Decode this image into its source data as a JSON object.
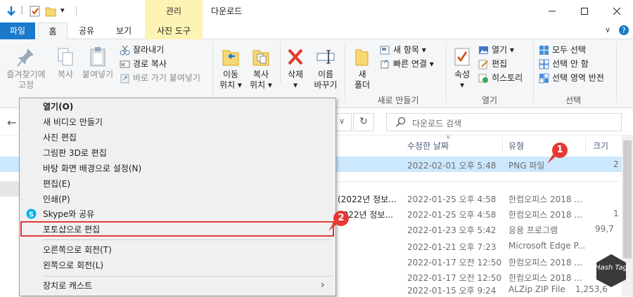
{
  "window": {
    "contextual_group": "관리",
    "title": "다운로드"
  },
  "tabs": {
    "file": "파일",
    "home": "홈",
    "share": "공유",
    "view": "보기",
    "picture_tools": "사진 도구"
  },
  "ribbon": {
    "pin_quick_access": "즐겨찾기에\n고정",
    "copy": "복사",
    "paste": "붙여넣기",
    "cut": "잘라내기",
    "copy_path": "경로 복사",
    "paste_shortcut": "바로 가기 붙여넣기",
    "move_to": "이동\n위치 ▾",
    "copy_to": "복사\n위치 ▾",
    "delete": "삭제\n▾",
    "rename": "이름\n바꾸기",
    "new_folder": "새\n폴더",
    "new_item": "새 항목 ▾",
    "easy_access": "빠른 연결 ▾",
    "group_new": "새로 만들기",
    "properties": "속성\n▾",
    "open": "열기 ▾",
    "edit": "편집",
    "history": "히스토리",
    "group_open": "열기",
    "select_all": "모두 선택",
    "select_none": "선택 안 함",
    "invert_selection": "선택 영역 반전",
    "group_select": "선택"
  },
  "search": {
    "placeholder": "다운로드 검색"
  },
  "columns": {
    "modified": "수정한 날짜",
    "type": "유형",
    "size": "크기"
  },
  "files": [
    {
      "name": "",
      "modified": "2022-02-01 오후 5:48",
      "type": "PNG 파일",
      "size": "2"
    },
    {
      "name": "(2022년 정보...",
      "modified": "2022-01-25 오후 4:58",
      "type": "한컴오피스 2018 ...",
      "size": ""
    },
    {
      "name": "2022년 정보...",
      "modified": "2022-01-25 오후 4:58",
      "type": "한컴오피스 2018 ...",
      "size": "1"
    },
    {
      "name": "",
      "modified": "2022-01-23 오후 5:42",
      "type": "응용 프로그램",
      "size": "99,7"
    },
    {
      "name": "",
      "modified": "2022-01-21 오후 7:23",
      "type": "Microsoft Edge P...",
      "size": ""
    },
    {
      "name": "",
      "modified": "2022-01-17 오전 12:50",
      "type": "한컴오피스 2018 ...",
      "size": ""
    },
    {
      "name": "",
      "modified": "2022-01-17 오전 12:50",
      "type": "한컴오피스 2018 ...",
      "size": ""
    },
    {
      "name": "",
      "modified": "2022-01-15 오후 9:24",
      "type": "ALZip ZIP File",
      "size": "1,253,6"
    }
  ],
  "context_menu": {
    "items": [
      "열기(O)",
      "새 비디오 만들기",
      "사진 편집",
      "그림판 3D로 편집",
      "바탕 화면 배경으로 설정(N)",
      "편집(E)",
      "인쇄(P)",
      "Skype와 공유",
      "포토샵으로 편집",
      "오른쪽으로 회전(T)",
      "왼쪽으로 회전(L)",
      "장치로 캐스트"
    ]
  },
  "badges": {
    "one": "1",
    "two": "2"
  },
  "watermark": "Hash Tag",
  "colors": {
    "accent": "#1979ca",
    "contextual": "#fdf3b3",
    "selection": "#cce8ff",
    "annotation": "#e53935"
  }
}
